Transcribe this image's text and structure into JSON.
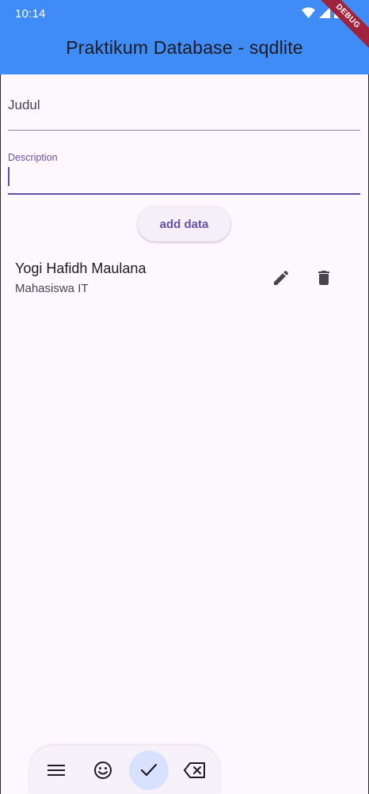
{
  "status_bar": {
    "time": "10:14"
  },
  "debug_banner": "DEBUG",
  "app_bar": {
    "title": "Praktikum Database - sqdlite"
  },
  "form": {
    "judul_label": "Judul",
    "description_label": "Description",
    "description_value": ""
  },
  "add_button_label": "add data",
  "items": [
    {
      "title": "Yogi Hafidh Maulana",
      "subtitle": "Mahasiswa IT"
    }
  ],
  "keyboard_toolbar": {
    "icons": [
      "menu-icon",
      "emoji-icon",
      "check-icon",
      "backspace-icon"
    ],
    "active_color": "#d8e2ff"
  },
  "colors": {
    "app_bar": "#3f8cf7",
    "background": "#fdf7fe",
    "accent": "#6750a4"
  }
}
